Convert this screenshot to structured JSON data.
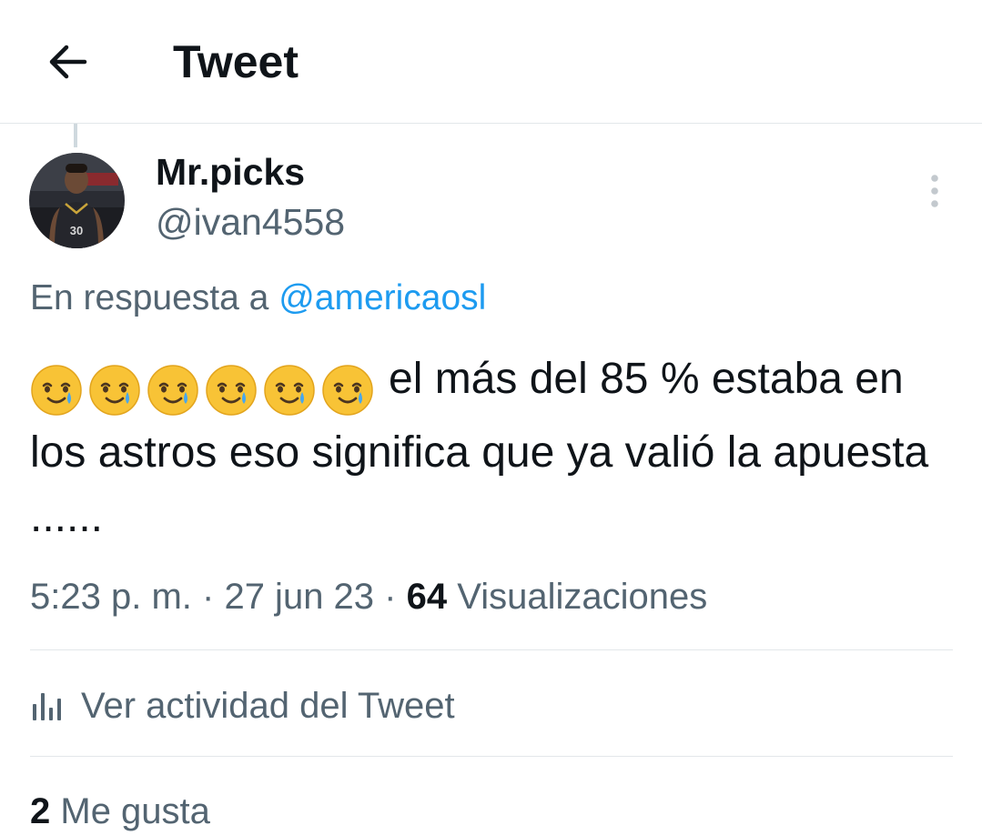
{
  "header": {
    "back_icon": "arrow-left-icon",
    "title": "Tweet"
  },
  "tweet": {
    "author": {
      "display_name": "Mr.picks",
      "handle": "@ivan4558",
      "avatar_jersey_number": "30"
    },
    "reply_context": {
      "prefix": "En respuesta a",
      "mention": "@americaosl"
    },
    "emojis": [
      "🥲",
      "🥲",
      "🥲",
      "🥲",
      "🥲",
      "🥲"
    ],
    "text": "el más del 85 % estaba en los astros eso significa que ya valió la apuesta ......",
    "time": "5:23 p. m.",
    "separator": "·",
    "date": "27 jun 23",
    "views_count": "64",
    "views_label": "Visualizaciones"
  },
  "activity": {
    "icon": "bar-chart-icon",
    "label": "Ver actividad del Tweet"
  },
  "likes": {
    "count": "2",
    "label": "Me gusta"
  },
  "colors": {
    "primary_text": "#0f1419",
    "secondary_text": "#536471",
    "link": "#1d9bf0",
    "divider": "#e3e7ea"
  }
}
